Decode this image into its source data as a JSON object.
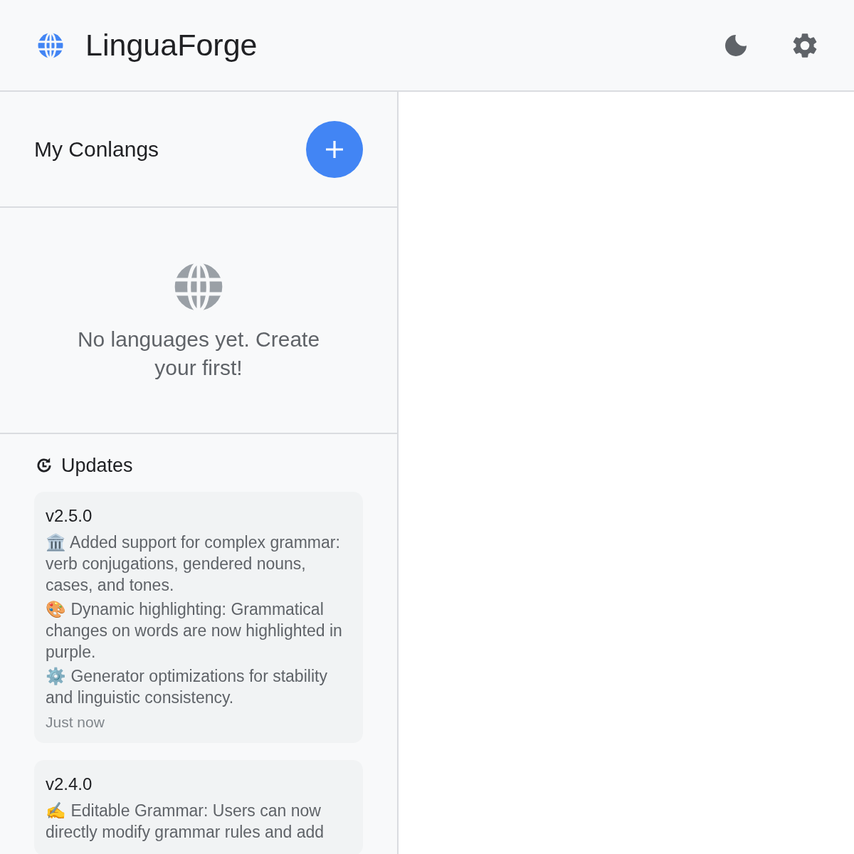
{
  "app": {
    "title": "LinguaForge"
  },
  "sidebar": {
    "title": "My Conlangs",
    "empty_message": "No languages yet. Create your first!"
  },
  "updates": {
    "title": "Updates",
    "items": [
      {
        "version": "v2.5.0",
        "lines": [
          "🏛️ Added support for complex grammar: verb conjugations, gendered nouns, cases, and tones.",
          "🎨 Dynamic highlighting: Grammatical changes on words are now highlighted in purple.",
          "⚙️ Generator optimizations for stability and linguistic consistency."
        ],
        "time": "Just now"
      },
      {
        "version": "v2.4.0",
        "lines": [
          "✍️ Editable Grammar: Users can now directly modify grammar rules and add"
        ]
      }
    ]
  }
}
